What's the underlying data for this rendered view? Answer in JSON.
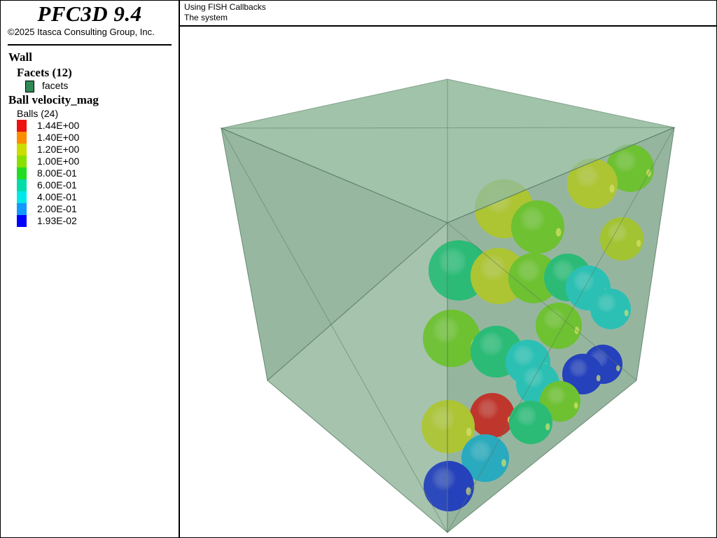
{
  "app": {
    "title": "PFC3D 9.4",
    "copyright": "©2025 Itasca Consulting Group, Inc."
  },
  "plot": {
    "title": "Using FISH Callbacks",
    "subtitle": "The system"
  },
  "legend": {
    "wall_heading": "Wall",
    "facets_heading": "Facets (12)",
    "facets_label": "facets",
    "facets_color": "#2e8b57",
    "ball_heading": "Ball velocity_mag",
    "balls_count": "Balls (24)",
    "colorbar": [
      {
        "label": "1.44E+00",
        "color": "#ee1111"
      },
      {
        "label": "1.40E+00",
        "color": "#ff8c00"
      },
      {
        "label": "1.20E+00",
        "color": "#ccdd00"
      },
      {
        "label": "1.00E+00",
        "color": "#88e000"
      },
      {
        "label": "8.00E-01",
        "color": "#22dd22"
      },
      {
        "label": "6.00E-01",
        "color": "#00ddaa"
      },
      {
        "label": "4.00E-01",
        "color": "#00e8e8"
      },
      {
        "label": "2.00E-01",
        "color": "#1199ff"
      },
      {
        "label": "1.93E-02",
        "color": "#0000ff"
      }
    ]
  },
  "scene": {
    "wall_fill": "#6fa07f",
    "balls": [
      {
        "velocity_mag": 0.95,
        "color": "#6fd016"
      },
      {
        "velocity_mag": 1.2,
        "color": "#c6d418"
      },
      {
        "velocity_mag": 1.2,
        "color": "#c6d418"
      },
      {
        "velocity_mag": 1.0,
        "color": "#6fd016"
      },
      {
        "velocity_mag": 1.15,
        "color": "#b8d418"
      },
      {
        "velocity_mag": 0.7,
        "color": "#12c877"
      },
      {
        "velocity_mag": 1.2,
        "color": "#c6d418"
      },
      {
        "velocity_mag": 1.0,
        "color": "#6fd016"
      },
      {
        "velocity_mag": 0.7,
        "color": "#12c877"
      },
      {
        "velocity_mag": 0.5,
        "color": "#14cfcb"
      },
      {
        "velocity_mag": 0.5,
        "color": "#14cfcb"
      },
      {
        "velocity_mag": 1.0,
        "color": "#6fd016"
      },
      {
        "velocity_mag": 0.95,
        "color": "#6fd016"
      },
      {
        "velocity_mag": 0.7,
        "color": "#12c877"
      },
      {
        "velocity_mag": 0.02,
        "color": "#0a1fd6"
      },
      {
        "velocity_mag": 0.02,
        "color": "#0a1fd6"
      },
      {
        "velocity_mag": 0.5,
        "color": "#14cfcb"
      },
      {
        "velocity_mag": 0.5,
        "color": "#14cfcb"
      },
      {
        "velocity_mag": 1.0,
        "color": "#6fd016"
      },
      {
        "velocity_mag": 1.44,
        "color": "#e01010"
      },
      {
        "velocity_mag": 0.75,
        "color": "#12c877"
      },
      {
        "velocity_mag": 1.2,
        "color": "#c6d418"
      },
      {
        "velocity_mag": 0.35,
        "color": "#10b0d8"
      },
      {
        "velocity_mag": 0.02,
        "color": "#0a1fd6"
      }
    ]
  }
}
